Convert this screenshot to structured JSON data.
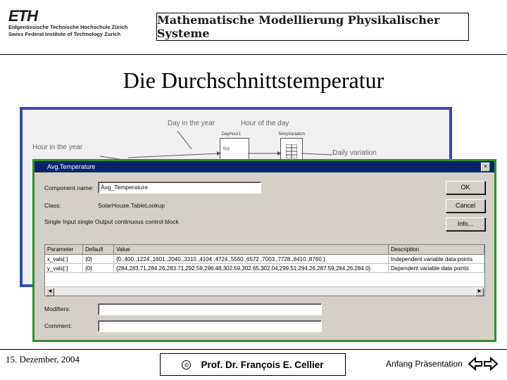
{
  "header": {
    "logo": {
      "mark": "ETH",
      "line1": "Eidgenössische Technische Hochschule Zürich",
      "line2": "Swiss Federal Institute of Technology Zurich"
    },
    "course_title": "Mathematische Modellierung Physikalischer Systeme"
  },
  "slide": {
    "title": "Die Durchschnittstemperatur"
  },
  "background_model": {
    "labels": {
      "day_in_year": "Day in the year",
      "hour_of_day": "Hour of the day",
      "hour_in_year": "Hour in the year",
      "daily_variation": "Daily variation",
      "block_dayhour": "DayHour1",
      "block_tempvariation": "TempVariation",
      "block_fcn": "f(u)"
    }
  },
  "dialog": {
    "title": "Avg.Temperature",
    "close": "×",
    "component_name_label": "Component name:",
    "component_name_value": "Avg_Temperature",
    "class_label": "Class:",
    "class_value": "SolarHouse.TableLookup",
    "description_text": "Single Input single Output continuous control block",
    "buttons": {
      "ok": "OK",
      "cancel": "Cancel",
      "info": "Info..."
    },
    "grid": {
      "headers": [
        "Parameter",
        "Default",
        "Value",
        "Description"
      ],
      "rows": [
        [
          "x_vals[:]",
          "{0}",
          "{0.,400.,1224.,1601.,2040.,3310.,4104.,4724.,5560.,6572.,7003.,7728.,8410.,8760.}",
          "Independent variable data points"
        ],
        [
          "y_vals[:]",
          "{0}",
          "{284,283.71,284.26,283.71,292.59,296.48,302.59,302.65,302.04,299.51,294.26,287.59,284.26,284.0}",
          "Dependent variable data points"
        ]
      ]
    },
    "modifiers_label": "Modifiers:",
    "comment_label": "Comment:",
    "modifiers_value": "",
    "comment_value": ""
  },
  "footer": {
    "date": "15. Dezember, 2004",
    "copyright": "©",
    "author": "Prof. Dr. François E. Cellier",
    "link": "Anfang Präsentation"
  }
}
